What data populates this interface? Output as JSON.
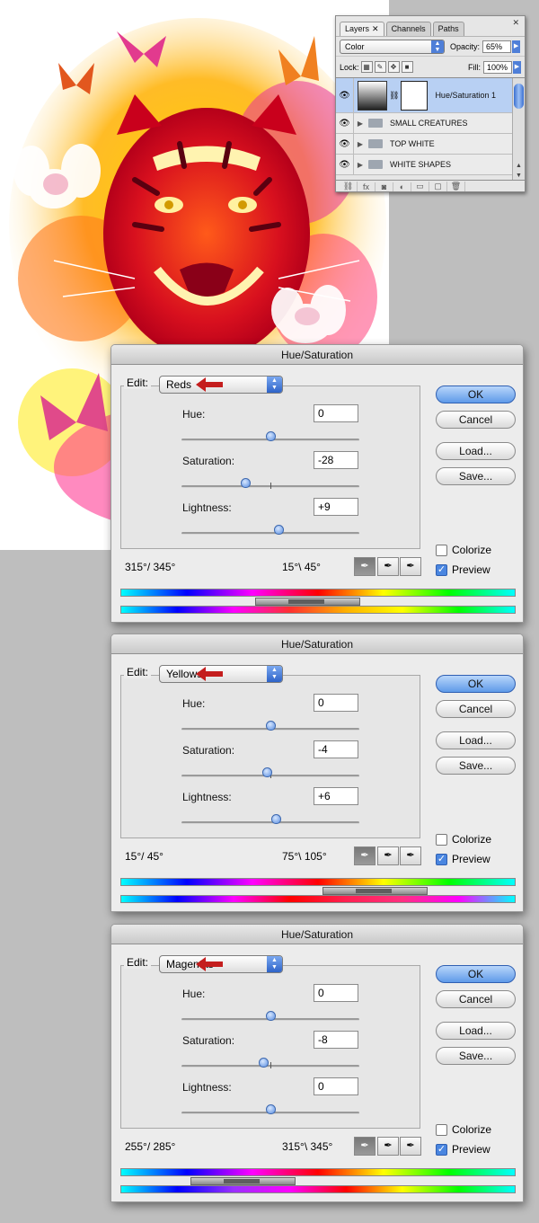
{
  "layers_panel": {
    "tabs": [
      "Layers",
      "Channels",
      "Paths"
    ],
    "blend_mode": "Color",
    "opacity_label": "Opacity:",
    "opacity": "65%",
    "lock_label": "Lock:",
    "fill_label": "Fill:",
    "fill": "100%",
    "layers": [
      {
        "name": "Hue/Saturation 1",
        "type": "adjustment",
        "selected": true
      },
      {
        "name": "SMALL CREATURES",
        "type": "group"
      },
      {
        "name": "TOP WHITE",
        "type": "group"
      },
      {
        "name": "WHITE SHAPES",
        "type": "group"
      }
    ],
    "bottom_icons": [
      "link-icon",
      "fx-icon",
      "mask-icon",
      "adjustment-icon",
      "folder-icon",
      "new-layer-icon",
      "trash-icon"
    ]
  },
  "dialogs": [
    {
      "title": "Hue/Saturation",
      "edit_label": "Edit:",
      "edit_value": "Reds",
      "hue_label": "Hue:",
      "hue": "0",
      "saturation_label": "Saturation:",
      "saturation": "-28",
      "lightness_label": "Lightness:",
      "lightness": "+9",
      "ok": "OK",
      "cancel": "Cancel",
      "load": "Load...",
      "save": "Save...",
      "colorize_label": "Colorize",
      "colorize": false,
      "preview_label": "Preview",
      "preview": true,
      "range_left": "315°/ 345°",
      "range_right": "15°\\ 45°"
    },
    {
      "title": "Hue/Saturation",
      "edit_label": "Edit:",
      "edit_value": "Yellows",
      "hue_label": "Hue:",
      "hue": "0",
      "saturation_label": "Saturation:",
      "saturation": "-4",
      "lightness_label": "Lightness:",
      "lightness": "+6",
      "ok": "OK",
      "cancel": "Cancel",
      "load": "Load...",
      "save": "Save...",
      "colorize_label": "Colorize",
      "colorize": false,
      "preview_label": "Preview",
      "preview": true,
      "range_left": "15°/ 45°",
      "range_right": "75°\\ 105°"
    },
    {
      "title": "Hue/Saturation",
      "edit_label": "Edit:",
      "edit_value": "Magentas",
      "hue_label": "Hue:",
      "hue": "0",
      "saturation_label": "Saturation:",
      "saturation": "-8",
      "lightness_label": "Lightness:",
      "lightness": "0",
      "ok": "OK",
      "cancel": "Cancel",
      "load": "Load...",
      "save": "Save...",
      "colorize_label": "Colorize",
      "colorize": false,
      "preview_label": "Preview",
      "preview": true,
      "range_left": "255°/ 285°",
      "range_right": "315°\\ 345°"
    }
  ],
  "colors": {
    "accent_blue": "#5f9ae9",
    "arrow_red": "#c41e1e",
    "selected_layer": "#b8d0f3"
  }
}
